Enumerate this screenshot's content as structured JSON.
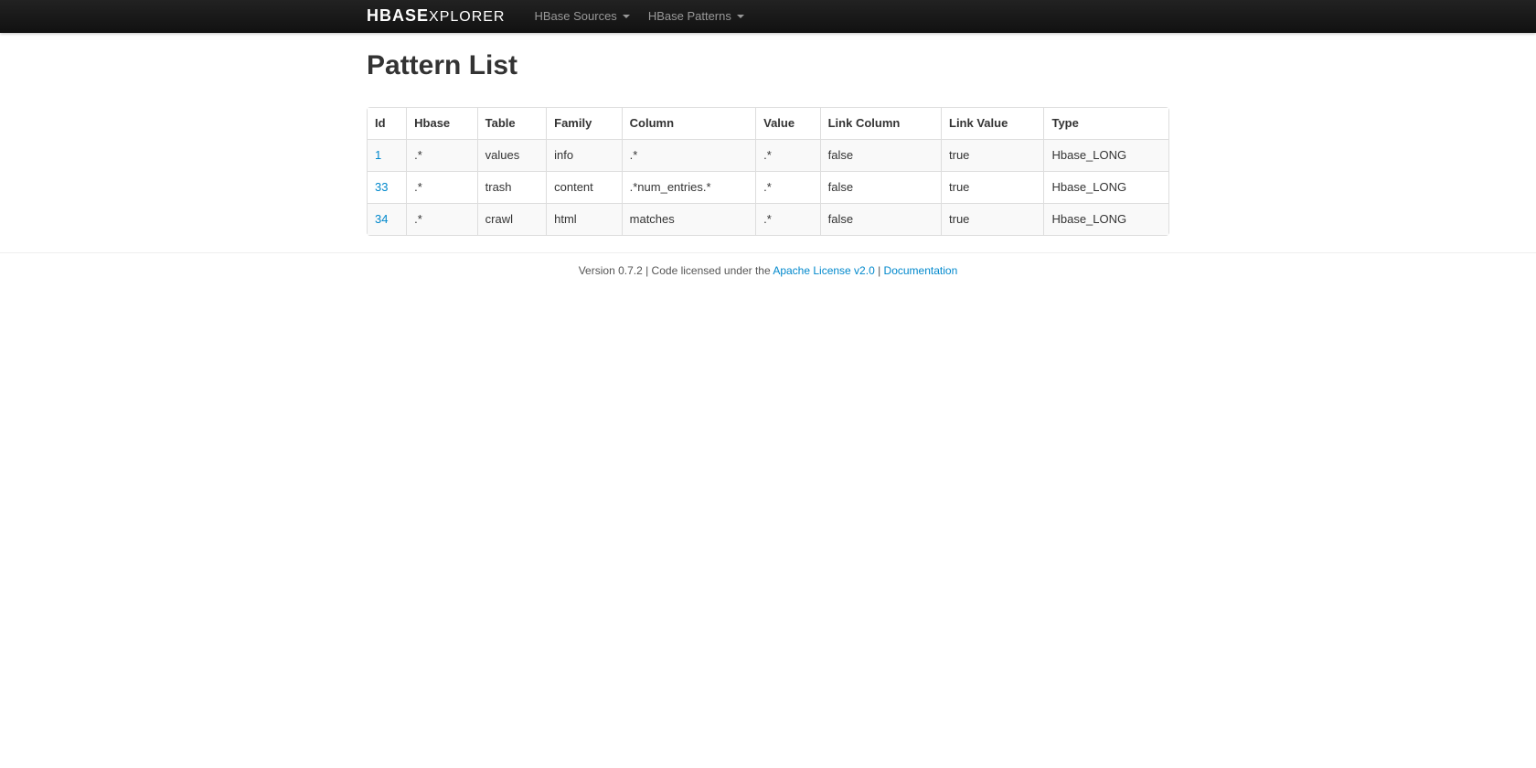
{
  "nav": {
    "brand_bold": "HBASE",
    "brand_light": "XPLORER",
    "items": [
      {
        "label": "HBase Sources"
      },
      {
        "label": "HBase Patterns"
      }
    ]
  },
  "page": {
    "title": "Pattern List"
  },
  "table": {
    "headers": [
      "Id",
      "Hbase",
      "Table",
      "Family",
      "Column",
      "Value",
      "Link Column",
      "Link Value",
      "Type"
    ],
    "rows": [
      {
        "id": "1",
        "hbase": ".*",
        "table": "values",
        "family": "info",
        "column": ".*",
        "value": ".*",
        "link_column": "false",
        "link_value": "true",
        "type": "Hbase_LONG"
      },
      {
        "id": "33",
        "hbase": ".*",
        "table": "trash",
        "family": "content",
        "column": ".*num_entries.*",
        "value": ".*",
        "link_column": "false",
        "link_value": "true",
        "type": "Hbase_LONG"
      },
      {
        "id": "34",
        "hbase": ".*",
        "table": "crawl",
        "family": "html",
        "column": "matches",
        "value": ".*",
        "link_column": "false",
        "link_value": "true",
        "type": "Hbase_LONG"
      }
    ]
  },
  "footer": {
    "prefix": "Version 0.7.2 | Code licensed under the ",
    "license_link": "Apache License v2.0",
    "sep": " | ",
    "doc_link": "Documentation"
  }
}
